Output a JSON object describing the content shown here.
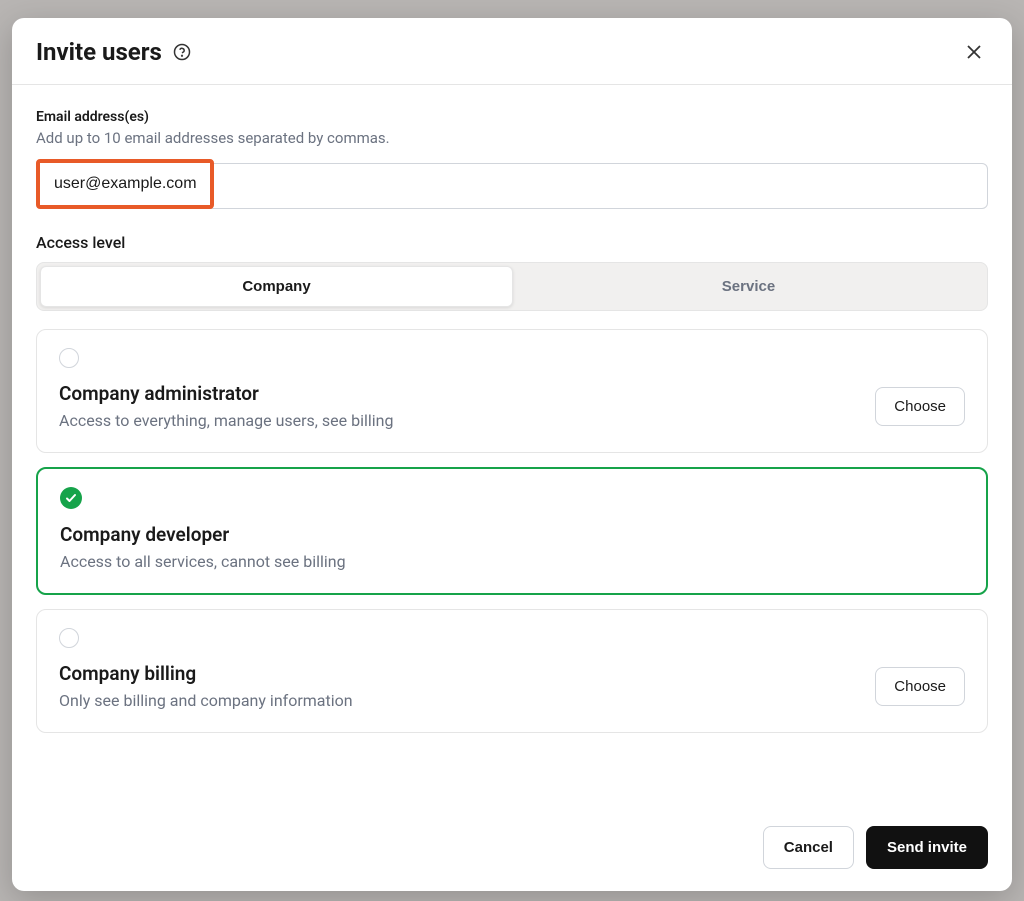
{
  "dialog": {
    "title": "Invite users"
  },
  "email_field": {
    "label": "Email address(es)",
    "help": "Add up to 10 email addresses separated by commas.",
    "value": "user@example.com"
  },
  "access_level": {
    "label": "Access level",
    "tabs": [
      {
        "label": "Company",
        "active": true
      },
      {
        "label": "Service",
        "active": false
      }
    ]
  },
  "roles": [
    {
      "title": "Company administrator",
      "description": "Access to everything, manage users, see billing",
      "selected": false,
      "choose_label": "Choose"
    },
    {
      "title": "Company developer",
      "description": "Access to all services, cannot see billing",
      "selected": true
    },
    {
      "title": "Company billing",
      "description": "Only see billing and company information",
      "selected": false,
      "choose_label": "Choose"
    }
  ],
  "footer": {
    "cancel_label": "Cancel",
    "submit_label": "Send invite"
  }
}
